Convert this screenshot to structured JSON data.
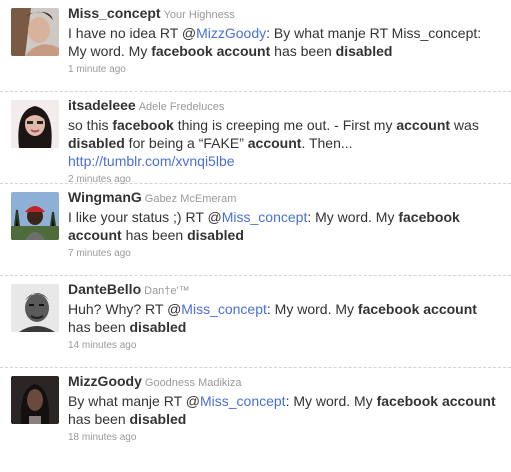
{
  "tweets": [
    {
      "screen_name": "Miss_concept",
      "full_name": "Your Highness",
      "avatar_icon": "user-avatar-photo",
      "segments": [
        {
          "t": "I have no idea RT @"
        },
        {
          "t": "MizzGoody",
          "link": true
        },
        {
          "t": ": By what manje RT Miss_concept: My word. My "
        },
        {
          "t": "facebook",
          "b": true
        },
        {
          "t": " "
        },
        {
          "t": "account",
          "b": true
        },
        {
          "t": " has been "
        },
        {
          "t": "disabled",
          "b": true
        }
      ],
      "time": "1 minute ago"
    },
    {
      "screen_name": "itsadeleee",
      "full_name": "Adele Fredeluces",
      "avatar_icon": "user-avatar-photo",
      "segments": [
        {
          "t": "so this "
        },
        {
          "t": "facebook",
          "b": true
        },
        {
          "t": " thing is creeping me out. - First my "
        },
        {
          "t": "account",
          "b": true
        },
        {
          "t": " was "
        },
        {
          "t": "disabled",
          "b": true
        },
        {
          "t": " for being a “FAKE” "
        },
        {
          "t": "account",
          "b": true
        },
        {
          "t": ". Then... "
        },
        {
          "t": "http://tumblr.com/xvnqi5lbe",
          "link": true
        }
      ],
      "time": "2 minutes ago"
    },
    {
      "screen_name": "WingmanG",
      "full_name": "Gabez McEmeram",
      "avatar_icon": "user-avatar-photo",
      "segments": [
        {
          "t": "I like your status ;) RT @"
        },
        {
          "t": "Miss_concept",
          "link": true
        },
        {
          "t": ": My word. My "
        },
        {
          "t": "facebook",
          "b": true
        },
        {
          "t": " "
        },
        {
          "t": "account",
          "b": true
        },
        {
          "t": " has been "
        },
        {
          "t": "disabled",
          "b": true
        }
      ],
      "time": "7 minutes ago"
    },
    {
      "screen_name": "DanteBello",
      "full_name": "Dan†e'™",
      "avatar_icon": "user-avatar-photo",
      "segments": [
        {
          "t": "Huh? Why? RT @"
        },
        {
          "t": "Miss_concept",
          "link": true
        },
        {
          "t": ": My word. My "
        },
        {
          "t": "facebook",
          "b": true
        },
        {
          "t": " "
        },
        {
          "t": "account",
          "b": true
        },
        {
          "t": " has been "
        },
        {
          "t": "disabled",
          "b": true
        }
      ],
      "time": "14 minutes ago"
    },
    {
      "screen_name": "MizzGoody",
      "full_name": "Goodness Madikiza",
      "avatar_icon": "user-avatar-photo",
      "segments": [
        {
          "t": "By what manje RT @"
        },
        {
          "t": "Miss_concept",
          "link": true
        },
        {
          "t": ": My word. My "
        },
        {
          "t": "facebook",
          "b": true
        },
        {
          "t": " "
        },
        {
          "t": "account",
          "b": true
        },
        {
          "t": " has been "
        },
        {
          "t": "disabled",
          "b": true
        }
      ],
      "time": "18 minutes ago"
    }
  ],
  "colors": {
    "link": "#4a6fd8",
    "text": "#333333",
    "meta": "#999999",
    "divider": "#d3d3d3"
  }
}
